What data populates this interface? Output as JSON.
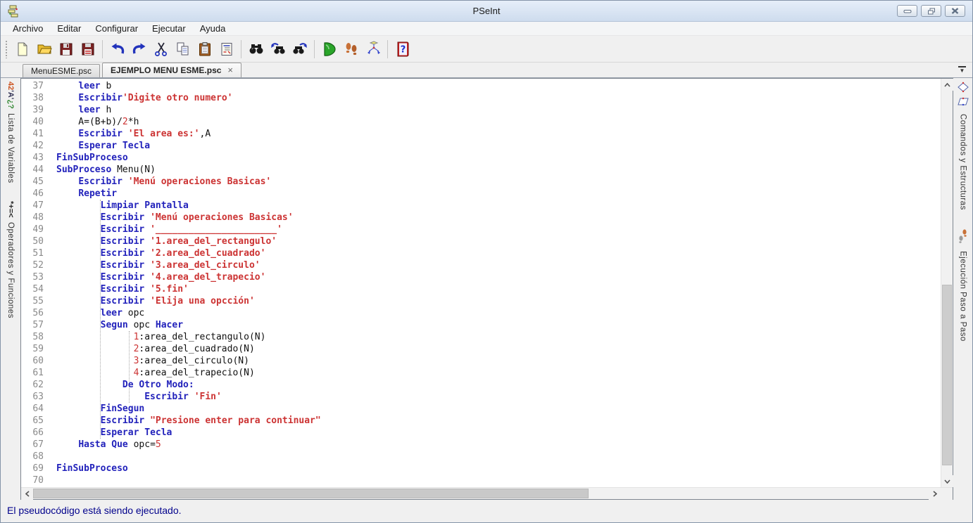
{
  "window": {
    "title": "PSeInt"
  },
  "titlebar": {
    "buttons": [
      "minimize",
      "restore",
      "close"
    ]
  },
  "menubar": {
    "items": [
      "Archivo",
      "Editar",
      "Configurar",
      "Ejecutar",
      "Ayuda"
    ]
  },
  "toolbar": {
    "buttons": [
      "new-file",
      "open-file",
      "save-file",
      "save-all",
      "undo",
      "redo",
      "cut",
      "copy",
      "paste",
      "format-code",
      "find",
      "find-previous",
      "find-next",
      "run",
      "run-step-by-step",
      "draw-flowchart",
      "help"
    ]
  },
  "tabbar": {
    "tabs": [
      {
        "label": "MenuESME.psc",
        "active": false
      },
      {
        "label": "EJEMPLO MENU ESME.psc",
        "active": true,
        "close_glyph": "×"
      }
    ]
  },
  "left_panel": {
    "tabs": [
      {
        "icon_text": "42'A'¿?",
        "label": "Lista de Variables"
      },
      {
        "icon_text": "*+=<",
        "label": "Operadores y Funciones"
      }
    ]
  },
  "right_panel": {
    "tabs": [
      {
        "icon": "flowchart-shapes-icon",
        "label": "Comandos y Estructuras"
      },
      {
        "icon": "footsteps-icon",
        "label": "Ejecución Paso a Paso"
      }
    ]
  },
  "editor": {
    "first_line": 37,
    "last_line": 70,
    "lines": [
      {
        "n": 37,
        "segs": [
          [
            "p",
            "    "
          ],
          [
            "k",
            "leer"
          ],
          [
            "p",
            " b"
          ]
        ]
      },
      {
        "n": 38,
        "segs": [
          [
            "p",
            "    "
          ],
          [
            "k",
            "Escribir"
          ],
          [
            "s",
            "'Digite otro numero'"
          ]
        ]
      },
      {
        "n": 39,
        "segs": [
          [
            "p",
            "    "
          ],
          [
            "k",
            "leer"
          ],
          [
            "p",
            " h"
          ]
        ]
      },
      {
        "n": 40,
        "segs": [
          [
            "p",
            "    A=(B+b)/"
          ],
          [
            "n",
            "2"
          ],
          [
            "p",
            "*h"
          ]
        ]
      },
      {
        "n": 41,
        "segs": [
          [
            "p",
            "    "
          ],
          [
            "k",
            "Escribir"
          ],
          [
            "p",
            " "
          ],
          [
            "s",
            "'El area es:'"
          ],
          [
            "p",
            ",A"
          ]
        ]
      },
      {
        "n": 42,
        "segs": [
          [
            "p",
            "    "
          ],
          [
            "k",
            "Esperar Tecla"
          ]
        ]
      },
      {
        "n": 43,
        "segs": [
          [
            "k",
            "FinSubProceso"
          ]
        ]
      },
      {
        "n": 44,
        "segs": [
          [
            "k",
            "SubProceso"
          ],
          [
            "p",
            " Menu(N)"
          ]
        ]
      },
      {
        "n": 45,
        "segs": [
          [
            "p",
            "    "
          ],
          [
            "k",
            "Escribir"
          ],
          [
            "p",
            " "
          ],
          [
            "s",
            "'Menú operaciones Basicas'"
          ]
        ]
      },
      {
        "n": 46,
        "segs": [
          [
            "p",
            "    "
          ],
          [
            "k",
            "Repetir"
          ]
        ]
      },
      {
        "n": 47,
        "segs": [
          [
            "p",
            "        "
          ],
          [
            "k",
            "Limpiar Pantalla"
          ]
        ]
      },
      {
        "n": 48,
        "segs": [
          [
            "p",
            "        "
          ],
          [
            "k",
            "Escribir"
          ],
          [
            "p",
            " "
          ],
          [
            "s",
            "'Menú operaciones Basicas'"
          ]
        ]
      },
      {
        "n": 49,
        "segs": [
          [
            "p",
            "        "
          ],
          [
            "k",
            "Escribir"
          ],
          [
            "p",
            " "
          ],
          [
            "s",
            "'______________________'"
          ]
        ]
      },
      {
        "n": 50,
        "segs": [
          [
            "p",
            "        "
          ],
          [
            "k",
            "Escribir"
          ],
          [
            "p",
            " "
          ],
          [
            "s",
            "'1.area_del_rectangulo'"
          ]
        ]
      },
      {
        "n": 51,
        "segs": [
          [
            "p",
            "        "
          ],
          [
            "k",
            "Escribir"
          ],
          [
            "p",
            " "
          ],
          [
            "s",
            "'2.area_del_cuadrado'"
          ]
        ]
      },
      {
        "n": 52,
        "segs": [
          [
            "p",
            "        "
          ],
          [
            "k",
            "Escribir"
          ],
          [
            "p",
            " "
          ],
          [
            "s",
            "'3.area_del_circulo'"
          ]
        ]
      },
      {
        "n": 53,
        "segs": [
          [
            "p",
            "        "
          ],
          [
            "k",
            "Escribir"
          ],
          [
            "p",
            " "
          ],
          [
            "s",
            "'4.area_del_trapecio'"
          ]
        ]
      },
      {
        "n": 54,
        "segs": [
          [
            "p",
            "        "
          ],
          [
            "k",
            "Escribir"
          ],
          [
            "p",
            " "
          ],
          [
            "s",
            "'5.fin'"
          ]
        ]
      },
      {
        "n": 55,
        "segs": [
          [
            "p",
            "        "
          ],
          [
            "k",
            "Escribir"
          ],
          [
            "p",
            " "
          ],
          [
            "s",
            "'Elija una opcción'"
          ]
        ]
      },
      {
        "n": 56,
        "segs": [
          [
            "p",
            "        "
          ],
          [
            "k",
            "leer"
          ],
          [
            "p",
            " opc"
          ]
        ]
      },
      {
        "n": 57,
        "segs": [
          [
            "p",
            "        "
          ],
          [
            "k",
            "Segun"
          ],
          [
            "p",
            " opc "
          ],
          [
            "k",
            "Hacer"
          ]
        ]
      },
      {
        "n": 58,
        "segs": [
          [
            "p",
            "              "
          ],
          [
            "n",
            "1"
          ],
          [
            "p",
            ":area_del_rectangulo(N)"
          ]
        ]
      },
      {
        "n": 59,
        "segs": [
          [
            "p",
            "              "
          ],
          [
            "n",
            "2"
          ],
          [
            "p",
            ":area_del_cuadrado(N)"
          ]
        ]
      },
      {
        "n": 60,
        "segs": [
          [
            "p",
            "              "
          ],
          [
            "n",
            "3"
          ],
          [
            "p",
            ":area_del_circulo(N)"
          ]
        ]
      },
      {
        "n": 61,
        "segs": [
          [
            "p",
            "              "
          ],
          [
            "n",
            "4"
          ],
          [
            "p",
            ":area_del_trapecio(N)"
          ]
        ]
      },
      {
        "n": 62,
        "segs": [
          [
            "p",
            "            "
          ],
          [
            "k",
            "De Otro Modo:"
          ]
        ]
      },
      {
        "n": 63,
        "segs": [
          [
            "p",
            "                "
          ],
          [
            "k",
            "Escribir"
          ],
          [
            "p",
            " "
          ],
          [
            "s",
            "'Fin'"
          ]
        ]
      },
      {
        "n": 64,
        "segs": [
          [
            "p",
            "        "
          ],
          [
            "k",
            "FinSegun"
          ]
        ]
      },
      {
        "n": 65,
        "segs": [
          [
            "p",
            "        "
          ],
          [
            "k",
            "Escribir"
          ],
          [
            "p",
            " "
          ],
          [
            "s",
            "\"Presione enter para continuar\""
          ]
        ]
      },
      {
        "n": 66,
        "segs": [
          [
            "p",
            "        "
          ],
          [
            "k",
            "Esperar Tecla"
          ]
        ]
      },
      {
        "n": 67,
        "segs": [
          [
            "p",
            "    "
          ],
          [
            "k",
            "Hasta Que"
          ],
          [
            "p",
            " opc="
          ],
          [
            "n",
            "5"
          ]
        ]
      },
      {
        "n": 68,
        "segs": []
      },
      {
        "n": 69,
        "segs": [
          [
            "k",
            "FinSubProceso"
          ]
        ]
      },
      {
        "n": 70,
        "segs": []
      }
    ]
  },
  "statusbar": {
    "text": "El pseudocódigo está siendo ejecutado."
  },
  "colors": {
    "keyword": "#2222bb",
    "string": "#cc3333",
    "number": "#cc3333",
    "line_number": "#8a8a8a",
    "status_text": "#00008b",
    "titlebar_top": "#e6eef9",
    "titlebar_bottom": "#cedcee"
  }
}
